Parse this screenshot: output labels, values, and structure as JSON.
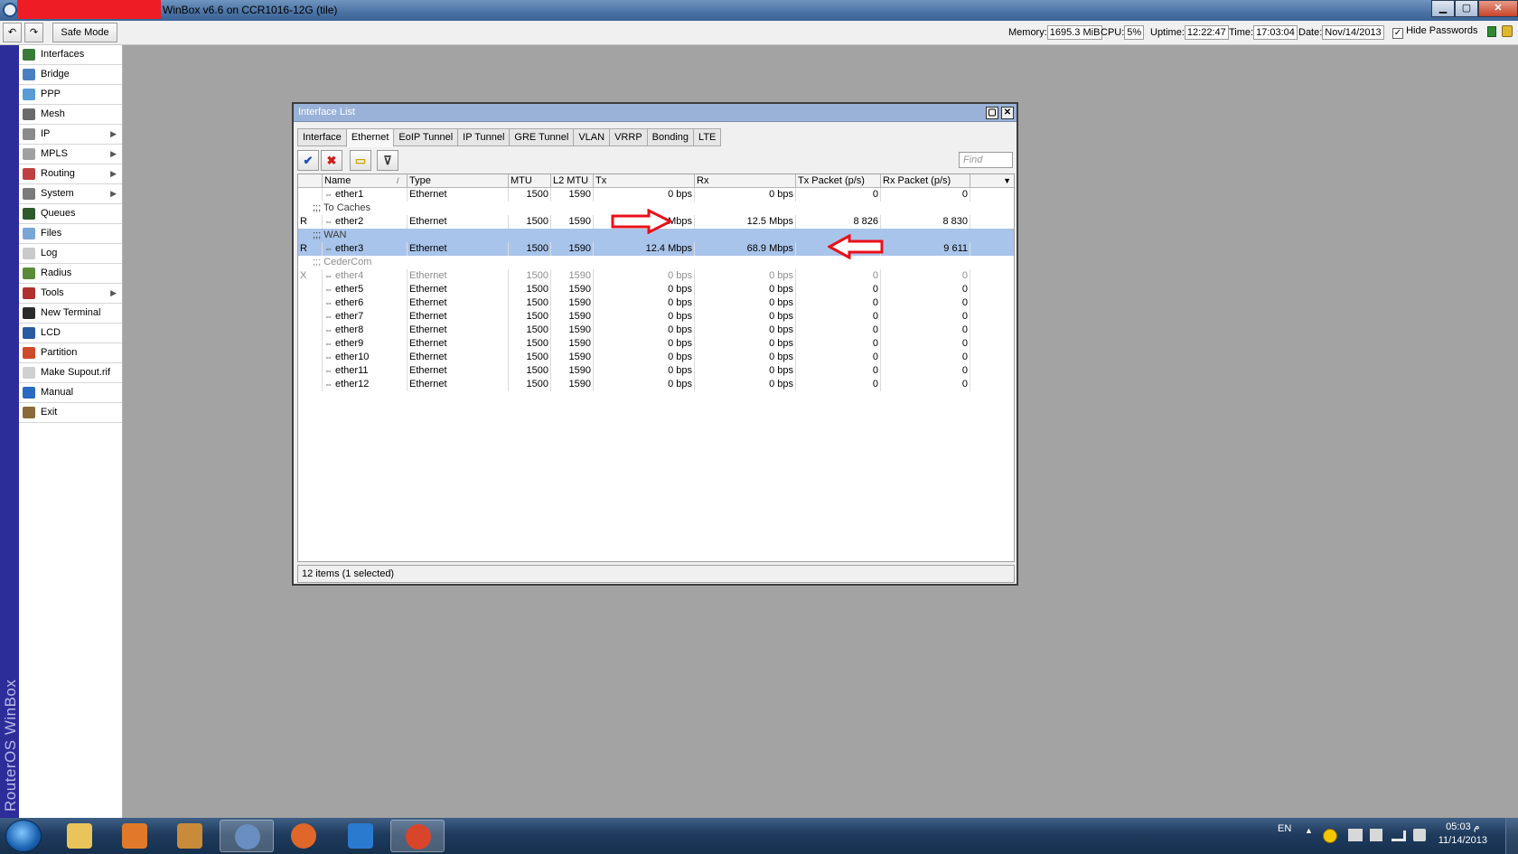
{
  "titlebar": {
    "title": "WinBox v6.6 on CCR1016-12G (tile)",
    "min": "▁",
    "max": "▢",
    "close": "✕"
  },
  "toolbar": {
    "undo": "↶",
    "redo": "↷",
    "safe_mode": "Safe Mode",
    "memory_label": "Memory:",
    "memory": "1695.3 MiB",
    "cpu_label": "CPU:",
    "cpu": "5%",
    "uptime_label": "Uptime:",
    "uptime": "12:22:47",
    "time_label": "Time:",
    "time": "17:03:04",
    "date_label": "Date:",
    "date": "Nov/14/2013",
    "hide_passwords": "Hide Passwords",
    "check": "✓"
  },
  "brand": "RouterOS WinBox",
  "menu": [
    {
      "label": "Interfaces",
      "icon": "interfaces-icon",
      "color": "#3b7a3b",
      "arrow": ""
    },
    {
      "label": "Bridge",
      "icon": "bridge-icon",
      "color": "#4b7fc1",
      "arrow": ""
    },
    {
      "label": "PPP",
      "icon": "ppp-icon",
      "color": "#5a9bd5",
      "arrow": ""
    },
    {
      "label": "Mesh",
      "icon": "mesh-icon",
      "color": "#6a6a6a",
      "arrow": ""
    },
    {
      "label": "IP",
      "icon": "ip-icon",
      "color": "#8a8a8a",
      "arrow": "▶"
    },
    {
      "label": "MPLS",
      "icon": "mpls-icon",
      "color": "#a0a0a0",
      "arrow": "▶"
    },
    {
      "label": "Routing",
      "icon": "routing-icon",
      "color": "#c04040",
      "arrow": "▶"
    },
    {
      "label": "System",
      "icon": "system-icon",
      "color": "#7a7a7a",
      "arrow": "▶"
    },
    {
      "label": "Queues",
      "icon": "queues-icon",
      "color": "#2f5a2f",
      "arrow": ""
    },
    {
      "label": "Files",
      "icon": "files-icon",
      "color": "#7aa6d6",
      "arrow": ""
    },
    {
      "label": "Log",
      "icon": "log-icon",
      "color": "#c9c9c9",
      "arrow": ""
    },
    {
      "label": "Radius",
      "icon": "radius-icon",
      "color": "#5a8a3a",
      "arrow": ""
    },
    {
      "label": "Tools",
      "icon": "tools-icon",
      "color": "#b03030",
      "arrow": "▶"
    },
    {
      "label": "New Terminal",
      "icon": "terminal-icon",
      "color": "#2a2a2a",
      "arrow": ""
    },
    {
      "label": "LCD",
      "icon": "lcd-icon",
      "color": "#2a5aa0",
      "arrow": ""
    },
    {
      "label": "Partition",
      "icon": "partition-icon",
      "color": "#d04a2a",
      "arrow": ""
    },
    {
      "label": "Make Supout.rif",
      "icon": "supout-icon",
      "color": "#d0d0d0",
      "arrow": ""
    },
    {
      "label": "Manual",
      "icon": "manual-icon",
      "color": "#2a6ac0",
      "arrow": ""
    },
    {
      "label": "Exit",
      "icon": "exit-icon",
      "color": "#8a6a3a",
      "arrow": ""
    }
  ],
  "window": {
    "title": "Interface List",
    "restore": "▢",
    "close": "✕",
    "tabs": [
      "Interface",
      "Ethernet",
      "EoIP Tunnel",
      "IP Tunnel",
      "GRE Tunnel",
      "VLAN",
      "VRRP",
      "Bonding",
      "LTE"
    ],
    "active_tab": 1,
    "tool_enable": "✔",
    "tool_disable": "✖",
    "tool_comment": "▭",
    "tool_filter": "⊽",
    "find_placeholder": "Find",
    "columns": [
      "",
      "Name",
      "Type",
      "MTU",
      "L2 MTU",
      "Tx",
      "Rx",
      "Tx Packet (p/s)",
      "Rx Packet (p/s)"
    ],
    "sort_marker": "/",
    "col_menu": "▼",
    "rows": [
      {
        "kind": "data",
        "flag": "",
        "name": "ether1",
        "type": "Ethernet",
        "mtu": "1500",
        "l2mtu": "1590",
        "tx": "0 bps",
        "rx": "0 bps",
        "txp": "0",
        "rxp": "0"
      },
      {
        "kind": "comment",
        "text": ";;; To Caches"
      },
      {
        "kind": "data",
        "flag": "R",
        "name": "ether2",
        "type": "Ethernet",
        "mtu": "1500",
        "l2mtu": "1590",
        "tx": "64.6 Mbps",
        "rx": "12.5 Mbps",
        "txp": "8 826",
        "rxp": "8 830"
      },
      {
        "kind": "comment",
        "text": ";;; WAN",
        "selected": true
      },
      {
        "kind": "data",
        "flag": "R",
        "name": "ether3",
        "type": "Ethernet",
        "mtu": "1500",
        "l2mtu": "1590",
        "tx": "12.4 Mbps",
        "rx": "68.9 Mbps",
        "txp": "8 877",
        "rxp": "9 611",
        "selected": true
      },
      {
        "kind": "comment",
        "text": ";;; CederCom",
        "disabled": true
      },
      {
        "kind": "data",
        "flag": "X",
        "name": "ether4",
        "type": "Ethernet",
        "mtu": "1500",
        "l2mtu": "1590",
        "tx": "0 bps",
        "rx": "0 bps",
        "txp": "0",
        "rxp": "0",
        "disabled": true
      },
      {
        "kind": "data",
        "flag": "",
        "name": "ether5",
        "type": "Ethernet",
        "mtu": "1500",
        "l2mtu": "1590",
        "tx": "0 bps",
        "rx": "0 bps",
        "txp": "0",
        "rxp": "0"
      },
      {
        "kind": "data",
        "flag": "",
        "name": "ether6",
        "type": "Ethernet",
        "mtu": "1500",
        "l2mtu": "1590",
        "tx": "0 bps",
        "rx": "0 bps",
        "txp": "0",
        "rxp": "0"
      },
      {
        "kind": "data",
        "flag": "",
        "name": "ether7",
        "type": "Ethernet",
        "mtu": "1500",
        "l2mtu": "1590",
        "tx": "0 bps",
        "rx": "0 bps",
        "txp": "0",
        "rxp": "0"
      },
      {
        "kind": "data",
        "flag": "",
        "name": "ether8",
        "type": "Ethernet",
        "mtu": "1500",
        "l2mtu": "1590",
        "tx": "0 bps",
        "rx": "0 bps",
        "txp": "0",
        "rxp": "0"
      },
      {
        "kind": "data",
        "flag": "",
        "name": "ether9",
        "type": "Ethernet",
        "mtu": "1500",
        "l2mtu": "1590",
        "tx": "0 bps",
        "rx": "0 bps",
        "txp": "0",
        "rxp": "0"
      },
      {
        "kind": "data",
        "flag": "",
        "name": "ether10",
        "type": "Ethernet",
        "mtu": "1500",
        "l2mtu": "1590",
        "tx": "0 bps",
        "rx": "0 bps",
        "txp": "0",
        "rxp": "0"
      },
      {
        "kind": "data",
        "flag": "",
        "name": "ether11",
        "type": "Ethernet",
        "mtu": "1500",
        "l2mtu": "1590",
        "tx": "0 bps",
        "rx": "0 bps",
        "txp": "0",
        "rxp": "0"
      },
      {
        "kind": "data",
        "flag": "",
        "name": "ether12",
        "type": "Ethernet",
        "mtu": "1500",
        "l2mtu": "1590",
        "tx": "0 bps",
        "rx": "0 bps",
        "txp": "0",
        "rxp": "0"
      }
    ],
    "iface_icon": "⇔",
    "status": "12 items (1 selected)"
  },
  "colors": {
    "annotation_arrow": "#e8101a",
    "selection": "#a9c4ea",
    "brand_bar": "#2d2d9a"
  },
  "taskbar": {
    "tasks": [
      {
        "icon": "explorer-icon",
        "color": "#e8c45a",
        "active": false
      },
      {
        "icon": "media-player-icon",
        "color": "#e07a2a",
        "active": false
      },
      {
        "icon": "archive-icon",
        "color": "#c98a3a",
        "active": false
      },
      {
        "icon": "winbox-icon",
        "color": "#6a8ec0",
        "active": true
      },
      {
        "icon": "firefox-icon",
        "color": "#e0662a",
        "active": false
      },
      {
        "icon": "teamviewer-icon",
        "color": "#2a7ad0",
        "active": false
      },
      {
        "icon": "chrome-icon",
        "color": "#d9452a",
        "active": true
      }
    ],
    "lang": "EN",
    "tray_up": "▲",
    "clock_time": "05:03 م",
    "clock_date": "11/14/2013"
  }
}
